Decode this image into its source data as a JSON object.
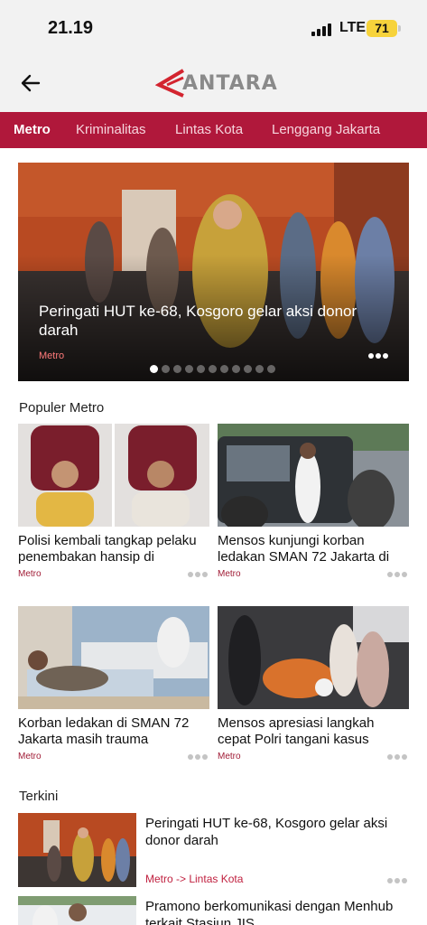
{
  "status": {
    "time": "21.19",
    "network": "LTE",
    "battery": "71"
  },
  "header": {
    "logo_text": "ANTARA",
    "back_icon": "arrow-left-icon"
  },
  "tabs": [
    {
      "label": "Metro",
      "active": true
    },
    {
      "label": "Kriminalitas",
      "active": false
    },
    {
      "label": "Lintas Kota",
      "active": false
    },
    {
      "label": "Lenggang Jakarta",
      "active": false
    }
  ],
  "hero": {
    "title": "Peringati HUT ke-68, Kosgoro gelar aksi donor darah",
    "category": "Metro",
    "slide_count": 11,
    "active_slide": 1
  },
  "popular": {
    "heading": "Populer Metro",
    "cards": [
      {
        "title": "Polisi kembali tangkap pelaku penembakan hansip di",
        "category": "Metro"
      },
      {
        "title": "Mensos kunjungi korban ledakan SMAN 72 Jakarta di",
        "category": "Metro"
      },
      {
        "title": "Korban ledakan di SMAN 72 Jakarta masih trauma",
        "category": "Metro"
      },
      {
        "title": "Mensos apresiasi langkah cepat Polri tangani kasus",
        "category": "Metro"
      }
    ]
  },
  "latest": {
    "heading": "Terkini",
    "items": [
      {
        "title": "Peringati HUT ke-68, Kosgoro gelar aksi donor darah",
        "category": "Metro -> Lintas Kota"
      },
      {
        "title": "Pramono berkomunikasi dengan Menhub terkait Stasiun JIS",
        "category": ""
      }
    ]
  },
  "colors": {
    "brand": "#b0183b",
    "category": "#a01c36",
    "accent_logo": "#d3242f"
  }
}
